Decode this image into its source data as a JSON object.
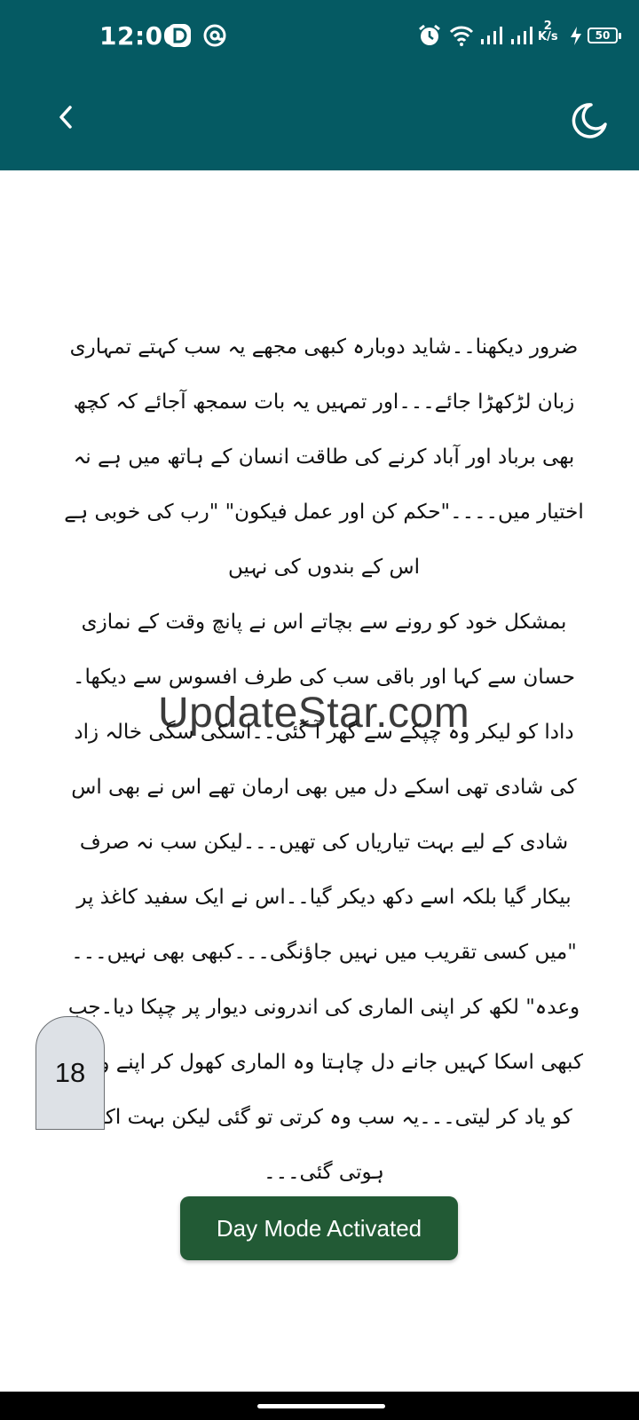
{
  "status_bar": {
    "time": "12:00",
    "network_speed_value": "2",
    "network_speed_unit": "K/s",
    "battery": "50",
    "icons": [
      "notification-d-icon",
      "notification-at-icon",
      "alarm-icon",
      "wifi-icon",
      "signal-icon",
      "signal-icon",
      "charging-icon",
      "battery-icon"
    ]
  },
  "app_bar": {
    "back_icon": "chevron-left-icon",
    "theme_icon": "moon-icon",
    "background": "#055a63"
  },
  "content": {
    "paragraphs": [
      "ضرور دیکھنا۔۔شاید دوبارہ کبھی مجھے یہ سب کہتے تمہاری زبان لڑکھڑا جائے۔۔۔اور تمہیں یہ بات سمجھ آجائے کہ کچھ بھی برباد اور آباد کرنے کی طاقت انسان کے ہاتھ میں ہے نہ اختیار میں۔۔۔۔\"حکم کن اور عمل فیکون\" \"رب کی خوبی ہے اس کے بندوں کی نہیں",
      "بمشکل خود کو رونے سے بچاتے اس نے پانچ وقت کے نمازی حسان سے کہا اور باقی سب کی طرف افسوس سے دیکھا۔",
      "دادا کو لیکر وہ چپکے سے گھر آ گئی۔۔اسکی سگی خالہ زاد کی شادی تھی اسکے دل میں بھی ارمان تھے اس نے بھی اس شادی کے لیے بہت تیاریاں کی تھیں۔۔۔لیکن سب نہ صرف بیکار گیا بلکہ اسے دکھ دیکر گیا۔۔اس نے ایک سفید کاغذ پر \"میں کسی تقریب میں نہیں جاؤنگی۔۔۔کبھی بھی نہیں۔۔۔وعدہ\" لکھ کر اپنی الماری کی اندرونی دیوار پر چپکا دیا۔جب کبھی اسکا کہیں جانے دل چاہتا وہ الماری کھول کر اپنے وعدے کو یاد کر لیتی۔۔۔یہ سب وہ کرتی تو گئی لیکن بہت اکیلی ہوتی گئی۔۔۔"
    ]
  },
  "watermark": "UpdateStar.com",
  "page_number": "18",
  "toast": {
    "message": "Day Mode Activated",
    "background": "#225a35"
  }
}
